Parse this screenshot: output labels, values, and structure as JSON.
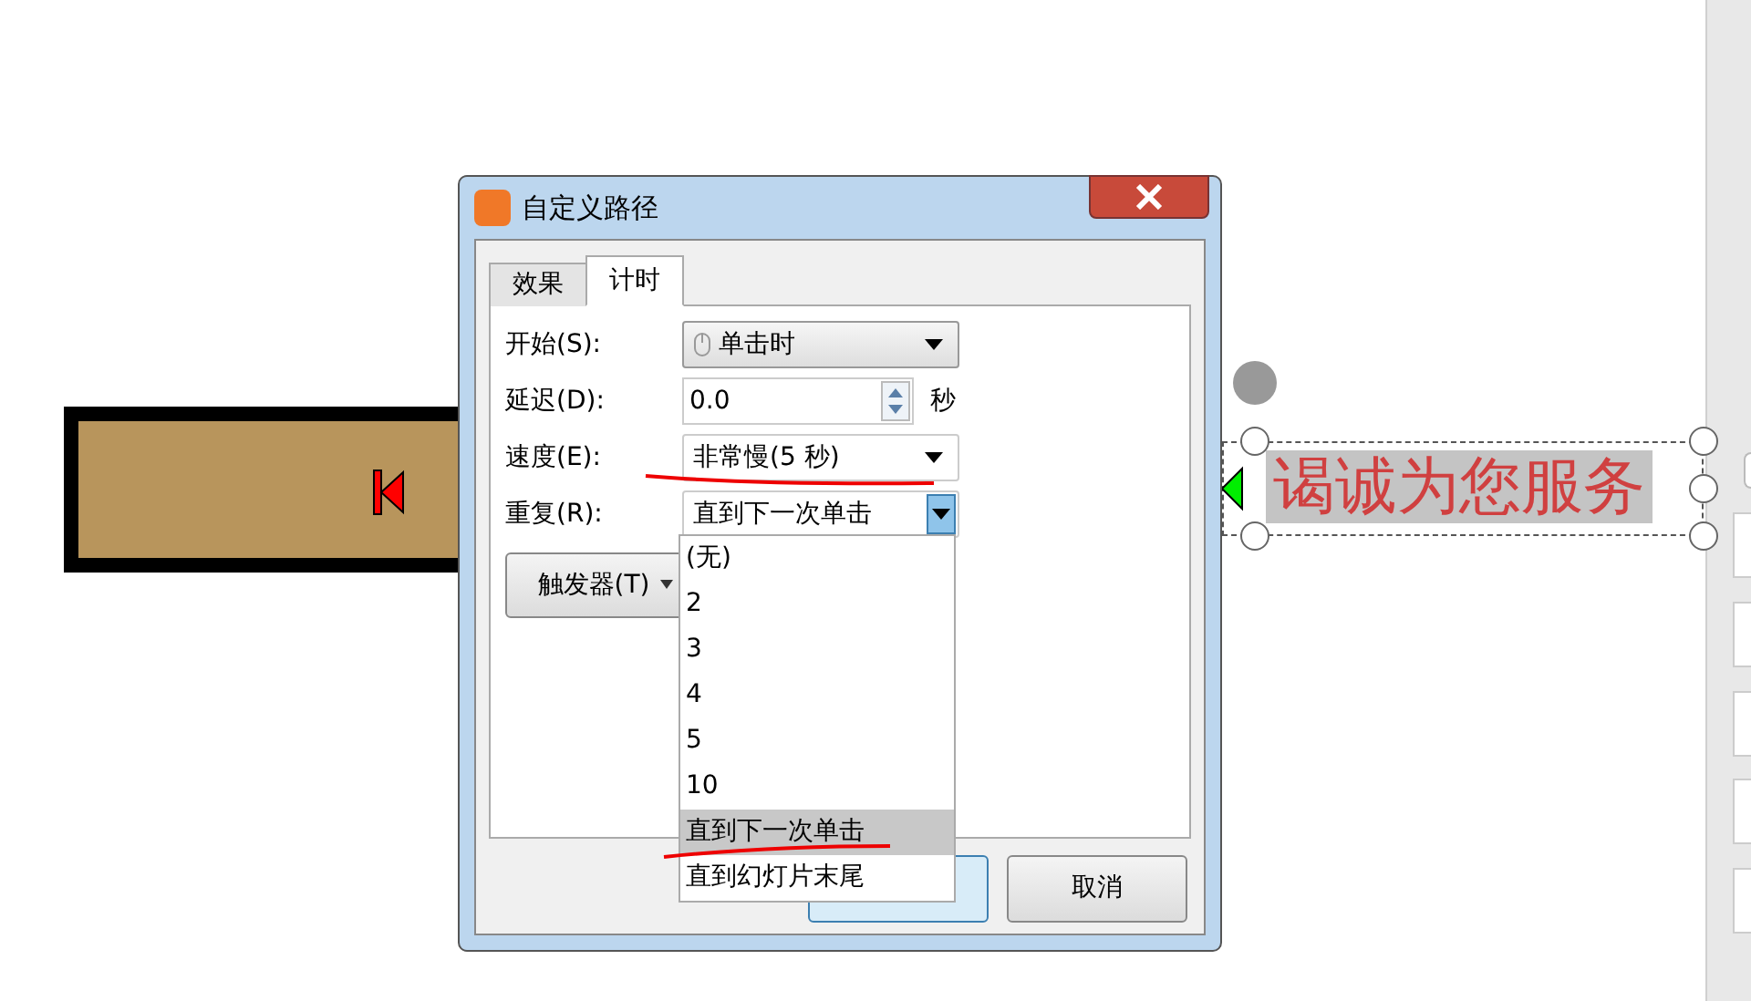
{
  "slide": {
    "text_box": "谒诚为您服务"
  },
  "dialog": {
    "title": "自定义路径",
    "tabs": [
      {
        "label": "效果",
        "selected": false
      },
      {
        "label": "计时",
        "selected": true
      }
    ],
    "fields": [
      {
        "label": "开始(S):",
        "kind": "dropdown",
        "value": "单击时",
        "icon": true,
        "open": false
      },
      {
        "label": "延迟(D):",
        "kind": "spinner",
        "value": "0.0",
        "unit": "秒"
      },
      {
        "label": "速度(E):",
        "kind": "dropdown",
        "value": "非常慢(5 秒)",
        "icon": false,
        "open": false
      },
      {
        "label": "重复(R):",
        "kind": "dropdown",
        "value": "直到下一次单击",
        "icon": false,
        "open": true
      }
    ],
    "trigger_button": "触发器(T)",
    "repeat_options": [
      {
        "label": "(无)",
        "selected": false
      },
      {
        "label": "2",
        "selected": false
      },
      {
        "label": "3",
        "selected": false
      },
      {
        "label": "4",
        "selected": false
      },
      {
        "label": "5",
        "selected": false
      },
      {
        "label": "10",
        "selected": false
      },
      {
        "label": "直到下一次单击",
        "selected": true
      },
      {
        "label": "直到幻灯片末尾",
        "selected": false
      }
    ],
    "cancel_button": "取消"
  }
}
